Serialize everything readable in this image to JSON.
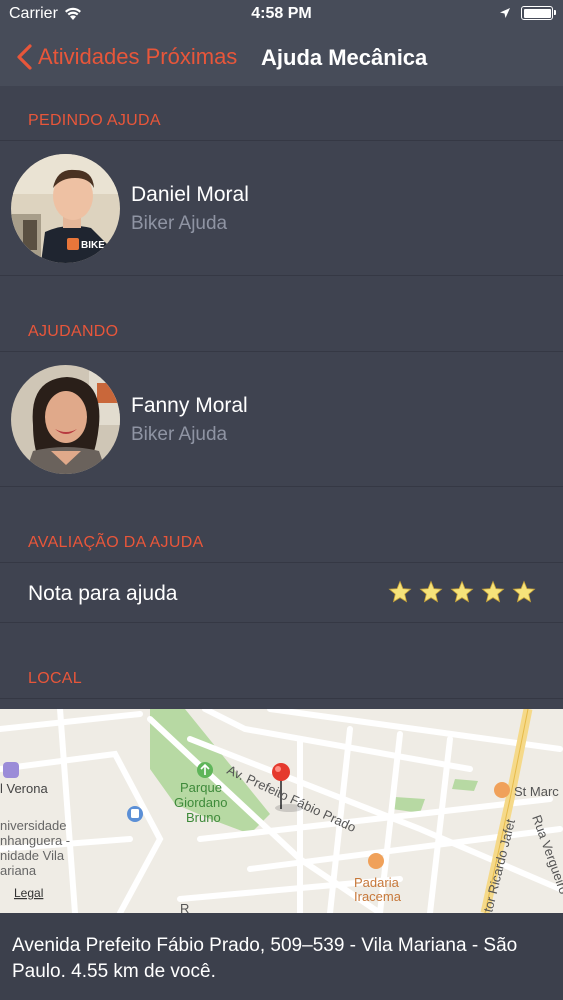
{
  "status_bar": {
    "carrier": "Carrier",
    "time": "4:58 PM"
  },
  "nav": {
    "back_label": "Atividades Próximas",
    "title": "Ajuda Mecânica"
  },
  "sections": {
    "requesting": "PEDINDO AJUDA",
    "helping": "AJUDANDO",
    "rating": "AVALIAÇÃO DA AJUDA",
    "location": "LOCAL"
  },
  "requester": {
    "name": "Daniel Moral",
    "role": "Biker Ajuda",
    "shirt_text": "BIKE AJ"
  },
  "helper": {
    "name": "Fanny Moral",
    "role": "Biker Ajuda"
  },
  "rating": {
    "label": "Nota para ajuda",
    "stars": 5,
    "max_stars": 5
  },
  "map": {
    "labels": {
      "verona": "l Verona",
      "university_1": "niversidade",
      "university_2": "nhanguera -",
      "university_3": "nidade Vila",
      "university_4": "ariana",
      "park_1": "Parque",
      "park_2": "Giordano",
      "park_3": "Bruno",
      "avenue": "Av. Prefeito Fábio Prado",
      "bakery_1": "Padaria",
      "bakery_2": "Iracema",
      "st_marc": "St Marc",
      "ricardo_jafet": "tor Ricardo Jafet",
      "vergueiro": "Rua Vergueiro",
      "legal": "Legal",
      "r": "R"
    }
  },
  "address": "Avenida Prefeito Fábio Prado, 509–539 - Vila Mariana - São Paulo. 4.55 km de você.",
  "colors": {
    "accent": "#e8563a",
    "background": "#3f4350",
    "bar": "#474c59",
    "secondary_text": "#8f94a3"
  }
}
